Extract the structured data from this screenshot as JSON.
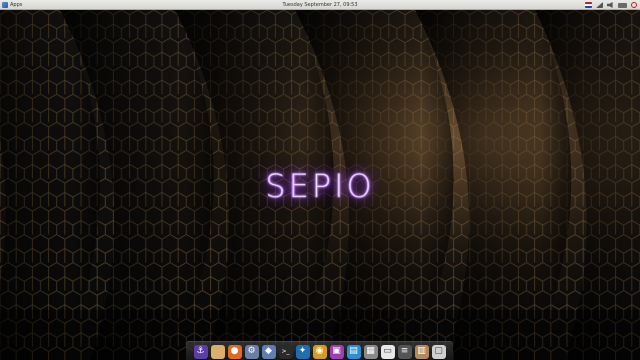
{
  "topbar": {
    "apps_label": "Apps",
    "clock": "Tuesday September 27, 09:53"
  },
  "wallpaper": {
    "logo_text": "SEPIO",
    "glow_color": "#a050ff",
    "accent_color": "#c08a4a"
  },
  "dock": {
    "items": [
      {
        "name": "anchor-app-icon",
        "glyph": "⚓",
        "color": "#5b3fa8"
      },
      {
        "name": "files-folder-icon",
        "glyph": "",
        "color": "#d8b06a"
      },
      {
        "name": "firefox-icon",
        "glyph": "●",
        "color": "#e06a1f"
      },
      {
        "name": "settings-gear-icon",
        "glyph": "⚙",
        "color": "#6d7ea6"
      },
      {
        "name": "visual-studio-code-icon",
        "glyph": "◆",
        "color": "#5f7fb2"
      },
      {
        "name": "terminal-icon",
        "glyph": ">_",
        "color": "#2a2a2a"
      },
      {
        "name": "network-graph-icon",
        "glyph": "✦",
        "color": "#1f6fb0"
      },
      {
        "name": "headphones-app-icon",
        "glyph": "◉",
        "color": "#d69a1c"
      },
      {
        "name": "purple-app-icon",
        "glyph": "▣",
        "color": "#9b3fb3"
      },
      {
        "name": "blue-app-icon",
        "glyph": "▤",
        "color": "#2a8fd1"
      },
      {
        "name": "image-viewer-icon",
        "glyph": "▦",
        "color": "#8a8a8a"
      },
      {
        "name": "document-icon",
        "glyph": "▭",
        "color": "#e8e8e8"
      },
      {
        "name": "audio-mixer-icon",
        "glyph": "≡",
        "color": "#555555"
      },
      {
        "name": "archive-box-icon",
        "glyph": "▥",
        "color": "#b08a5a"
      },
      {
        "name": "trash-icon",
        "glyph": "▢",
        "color": "#cfcfcf"
      }
    ]
  }
}
